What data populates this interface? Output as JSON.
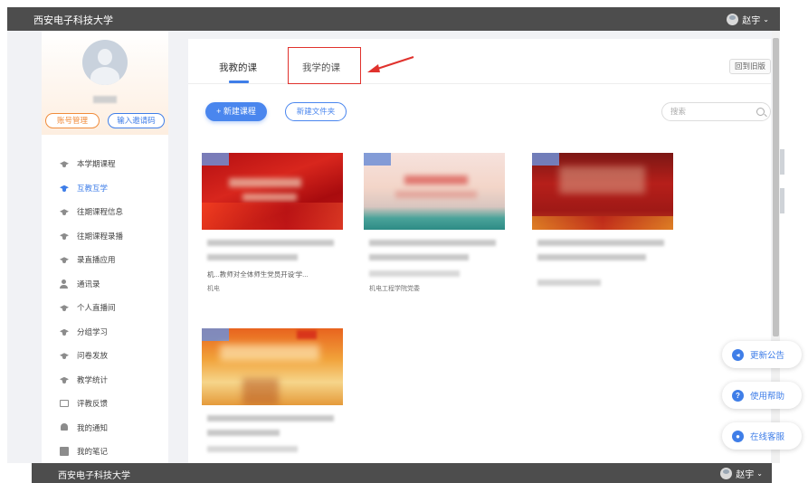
{
  "header": {
    "brand": "西安电子科技大学",
    "user_name": "赵宇"
  },
  "footer": {
    "brand": "西安电子科技大学",
    "user_name": "赵宇"
  },
  "profile": {
    "account_btn": "账号管理",
    "invite_btn": "输入邀请码"
  },
  "sidebar": {
    "items": [
      {
        "label": "本学期课程",
        "icon": "graduation-cap-icon"
      },
      {
        "label": "互教互学",
        "icon": "graduation-cap-icon",
        "active": true
      },
      {
        "label": "往期课程信息",
        "icon": "graduation-cap-icon"
      },
      {
        "label": "往期课程录播",
        "icon": "graduation-cap-icon"
      },
      {
        "label": "录直播应用",
        "icon": "graduation-cap-icon"
      },
      {
        "label": "通讯录",
        "icon": "contact-icon"
      },
      {
        "label": "个人直播间",
        "icon": "graduation-cap-icon"
      },
      {
        "label": "分组学习",
        "icon": "graduation-cap-icon"
      },
      {
        "label": "问卷发放",
        "icon": "graduation-cap-icon"
      },
      {
        "label": "教学统计",
        "icon": "graduation-cap-icon"
      },
      {
        "label": "评教反馈",
        "icon": "monitor-icon"
      },
      {
        "label": "我的通知",
        "icon": "bell-icon"
      },
      {
        "label": "我的笔记",
        "icon": "note-icon"
      }
    ]
  },
  "tabs": {
    "teach": "我教的课",
    "learn": "我学的课",
    "old_version": "回到旧版"
  },
  "toolbar": {
    "new_course": "+ 新建课程",
    "new_folder": "新建文件夹",
    "search_placeholder": "搜索"
  },
  "courses": [
    {
      "title": "机...教师对全体师生党员开设'学...",
      "subtitle": "机电"
    },
    {
      "title": "",
      "subtitle": "机电工程学院党委"
    },
    {
      "title": "",
      "subtitle": ""
    },
    {
      "title": "",
      "subtitle": ""
    }
  ],
  "float_buttons": {
    "announcement": "更新公告",
    "help": "使用帮助",
    "service": "在线客服"
  },
  "colors": {
    "accent": "#3f7ee8",
    "highlight_box": "#e0322d",
    "topbar": "#4d4d4d"
  }
}
